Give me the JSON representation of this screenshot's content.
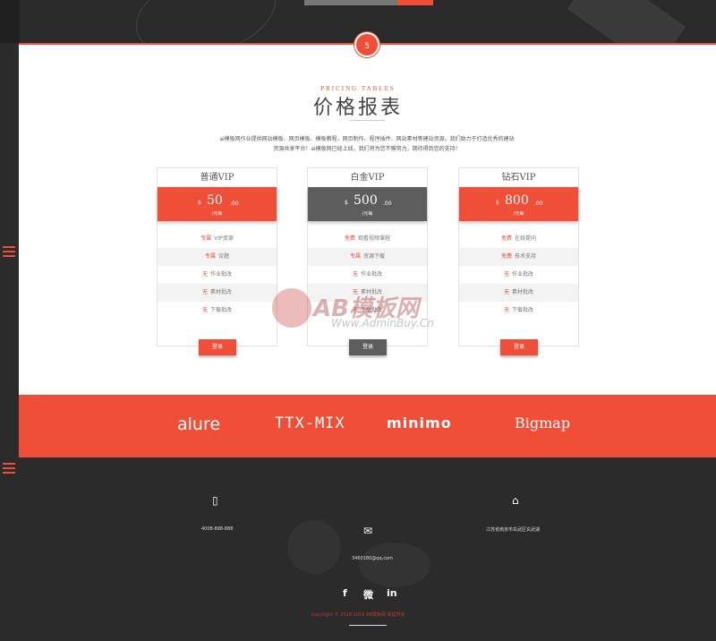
{
  "section_badge": "5",
  "pricing": {
    "subtitle": "PRICING TABLES",
    "title": "价格报表",
    "intro": "ai模板网作业提供网站模板、网页模板、模板教程、网页制作、程序插件、网站素材等建站资源。我们致力于打造优秀的建站资源共享平台！ai模板网已经上线，我们将为您不懈努力，期待得到您的支持！"
  },
  "plans": [
    {
      "name": "普通VIP",
      "currency": "$",
      "price": "50",
      "decimal": ".00",
      "unit": "/元每",
      "features": [
        {
          "highlight": "专属",
          "text": "VIP资源"
        },
        {
          "highlight": "专属",
          "text": "议题"
        },
        {
          "highlight": "无",
          "text": "作业批改"
        },
        {
          "highlight": "无",
          "text": "素材批改"
        },
        {
          "highlight": "无",
          "text": "下载批改"
        }
      ],
      "button": "登录"
    },
    {
      "name": "白金VIP",
      "currency": "$",
      "price": "500",
      "decimal": ".00",
      "unit": "/元每",
      "features": [
        {
          "highlight": "免费",
          "text": "观看视频课程"
        },
        {
          "highlight": "专属",
          "text": "资源下载"
        },
        {
          "highlight": "无",
          "text": "作业批改"
        },
        {
          "highlight": "无",
          "text": "素材批改"
        },
        {
          "highlight": "无",
          "text": "下载批改"
        }
      ],
      "button": "登录"
    },
    {
      "name": "钻石VIP",
      "currency": "$",
      "price": "800",
      "decimal": ".00",
      "unit": "/元每",
      "features": [
        {
          "highlight": "免费",
          "text": "在线提问"
        },
        {
          "highlight": "免费",
          "text": "技术支持"
        },
        {
          "highlight": "无",
          "text": "作业批改"
        },
        {
          "highlight": "无",
          "text": "素材批改"
        },
        {
          "highlight": "无",
          "text": "下载批改"
        }
      ],
      "button": "登录"
    }
  ],
  "watermark": {
    "logo_text": "AB模板网",
    "url": "Www.AdminBuy.Cn"
  },
  "partners": [
    "alure",
    "TTX-MIX",
    "minimo",
    "Bigmap"
  ],
  "footer": {
    "phone_icon": "phone-icon",
    "phone": "4008-888-888",
    "email_icon": "envelope-icon",
    "email": "3460180@qq.com",
    "home_icon": "home-icon",
    "address": "江苏省南京市玄武区玄武湖",
    "social": [
      "f",
      "微",
      "in"
    ],
    "copyright": "Copyright © 2018-2019 AB模板网 保留所有"
  },
  "colors": {
    "accent": "#f04e37",
    "dark": "#2b2b2b",
    "gray_plan": "#5d5d5d"
  }
}
